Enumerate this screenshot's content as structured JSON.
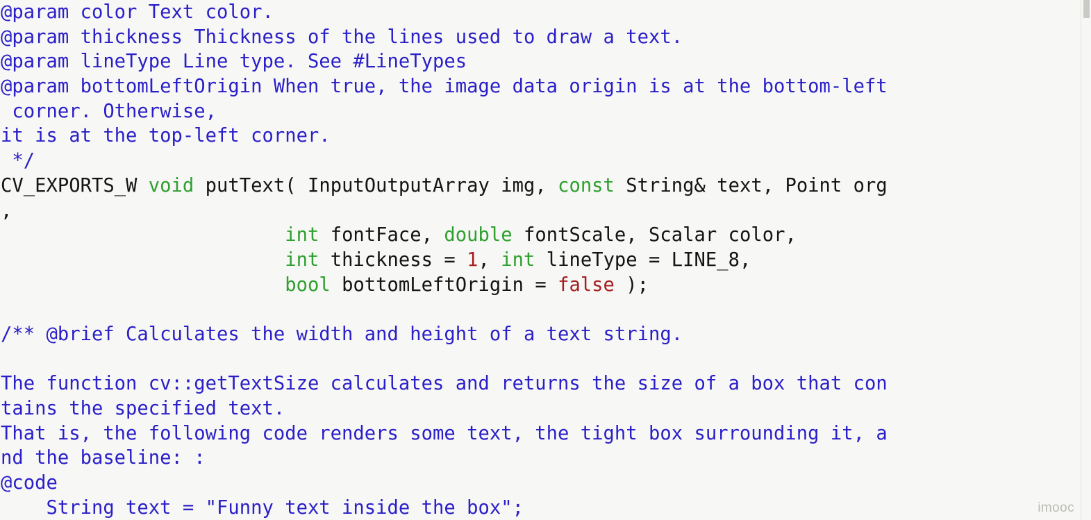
{
  "document": {
    "kind": "source-code-viewer",
    "language": "C++",
    "background_color": "#f7f7f5",
    "colors": {
      "comment": "#2a1fc8",
      "plain": "#141414",
      "keyword": "#2fa02f",
      "number": "#a52020",
      "literal": "#a52020",
      "watermark": "#b9b9b5",
      "scrollbar_thumb": "#c9c9c6"
    },
    "watermark": "imooc",
    "lines": [
      {
        "index": 0,
        "text": "@param color Text color.",
        "tokens": [
          {
            "t": "@param color Text color.",
            "c": "comment"
          }
        ]
      },
      {
        "index": 1,
        "text": "@param thickness Thickness of the lines used to draw a text.",
        "tokens": [
          {
            "t": "@param thickness Thickness of the lines used to draw a text.",
            "c": "comment"
          }
        ]
      },
      {
        "index": 2,
        "text": "@param lineType Line type. See #LineTypes",
        "tokens": [
          {
            "t": "@param lineType Line type. See #LineTypes",
            "c": "comment"
          }
        ]
      },
      {
        "index": 3,
        "text": "@param bottomLeftOrigin When true, the image data origin is at the bottom-left",
        "tokens": [
          {
            "t": "@param bottomLeftOrigin When true, the image data origin is at the bottom-left",
            "c": "comment"
          }
        ]
      },
      {
        "index": 4,
        "text": " corner. Otherwise,",
        "tokens": [
          {
            "t": " corner. Otherwise,",
            "c": "comment"
          }
        ]
      },
      {
        "index": 5,
        "text": "it is at the top-left corner.",
        "tokens": [
          {
            "t": "it is at the top-left corner.",
            "c": "comment"
          }
        ]
      },
      {
        "index": 6,
        "text": " */",
        "tokens": [
          {
            "t": " */",
            "c": "comment"
          }
        ]
      },
      {
        "index": 7,
        "text": "CV_EXPORTS_W void putText( InputOutputArray img, const String& text, Point org",
        "tokens": [
          {
            "t": "CV_EXPORTS_W ",
            "c": "plain"
          },
          {
            "t": "void",
            "c": "keyword"
          },
          {
            "t": " putText( InputOutputArray img, ",
            "c": "plain"
          },
          {
            "t": "const",
            "c": "keyword"
          },
          {
            "t": " String& text, Point org",
            "c": "plain"
          }
        ]
      },
      {
        "index": 8,
        "text": ",",
        "tokens": [
          {
            "t": ",",
            "c": "plain"
          }
        ]
      },
      {
        "index": 9,
        "text": "                         int fontFace, double fontScale, Scalar color,",
        "tokens": [
          {
            "t": "                         ",
            "c": "plain"
          },
          {
            "t": "int",
            "c": "keyword"
          },
          {
            "t": " fontFace, ",
            "c": "plain"
          },
          {
            "t": "double",
            "c": "keyword"
          },
          {
            "t": " fontScale, Scalar color,",
            "c": "plain"
          }
        ]
      },
      {
        "index": 10,
        "text": "                         int thickness = 1, int lineType = LINE_8,",
        "tokens": [
          {
            "t": "                         ",
            "c": "plain"
          },
          {
            "t": "int",
            "c": "keyword"
          },
          {
            "t": " thickness = ",
            "c": "plain"
          },
          {
            "t": "1",
            "c": "number"
          },
          {
            "t": ", ",
            "c": "plain"
          },
          {
            "t": "int",
            "c": "keyword"
          },
          {
            "t": " lineType = LINE_8,",
            "c": "plain"
          }
        ]
      },
      {
        "index": 11,
        "text": "                         bool bottomLeftOrigin = false );",
        "tokens": [
          {
            "t": "                         ",
            "c": "plain"
          },
          {
            "t": "bool",
            "c": "keyword"
          },
          {
            "t": " bottomLeftOrigin = ",
            "c": "plain"
          },
          {
            "t": "false",
            "c": "literal"
          },
          {
            "t": " );",
            "c": "plain"
          }
        ]
      },
      {
        "index": 12,
        "text": "",
        "tokens": [
          {
            "t": " ",
            "c": "blank"
          }
        ]
      },
      {
        "index": 13,
        "text": "/** @brief Calculates the width and height of a text string.",
        "tokens": [
          {
            "t": "/** @brief Calculates the width and height of a text string.",
            "c": "comment"
          }
        ]
      },
      {
        "index": 14,
        "text": "",
        "tokens": [
          {
            "t": " ",
            "c": "blank"
          }
        ]
      },
      {
        "index": 15,
        "text": "The function cv::getTextSize calculates and returns the size of a box that con",
        "tokens": [
          {
            "t": "The function cv::getTextSize calculates and returns the size of a box that con",
            "c": "comment"
          }
        ]
      },
      {
        "index": 16,
        "text": "tains the specified text.",
        "tokens": [
          {
            "t": "tains the specified text.",
            "c": "comment"
          }
        ]
      },
      {
        "index": 17,
        "text": "That is, the following code renders some text, the tight box surrounding it, a",
        "tokens": [
          {
            "t": "That is, the following code renders some text, the tight box surrounding it, a",
            "c": "comment"
          }
        ]
      },
      {
        "index": 18,
        "text": "nd the baseline: :",
        "tokens": [
          {
            "t": "nd the baseline: :",
            "c": "comment"
          }
        ]
      },
      {
        "index": 19,
        "text": "@code",
        "tokens": [
          {
            "t": "@code",
            "c": "comment"
          }
        ]
      },
      {
        "index": 20,
        "text": "    String text = \"Funny text inside the box\";",
        "tokens": [
          {
            "t": "    String text = \"Funny text inside the box\";",
            "c": "comment"
          }
        ]
      }
    ]
  }
}
